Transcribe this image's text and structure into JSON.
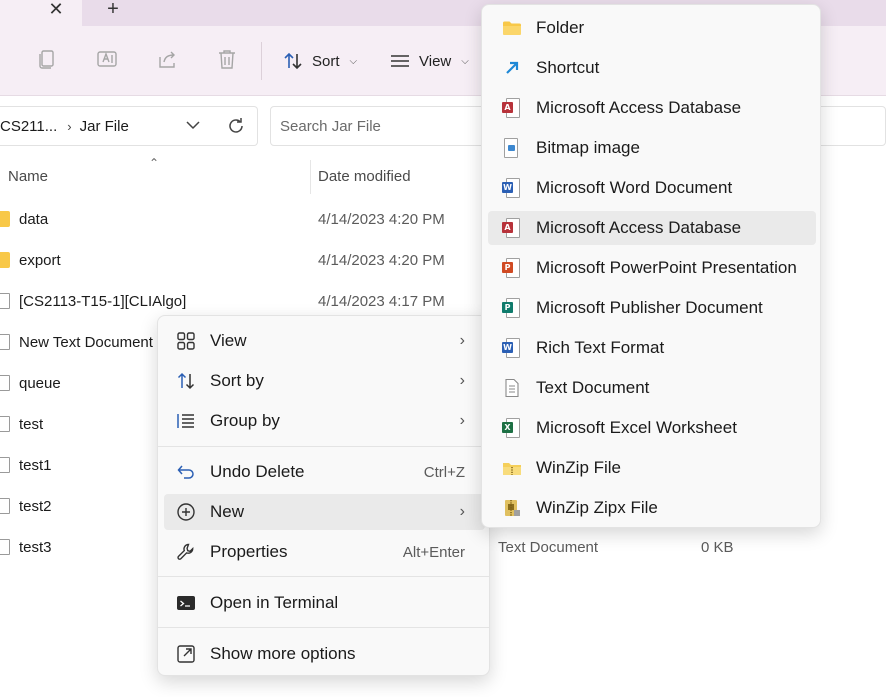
{
  "tabbar": {
    "close_glyph": "✕",
    "new_tab_glyph": "+"
  },
  "toolbar": {
    "sort_label": "Sort",
    "view_label": "View",
    "icons": [
      "copy-icon",
      "rename-icon",
      "share-icon",
      "delete-icon"
    ]
  },
  "address": {
    "crumbs": [
      "CS211...",
      "Jar File"
    ],
    "search_placeholder": "Search Jar File"
  },
  "columns": {
    "name": "Name",
    "date_modified": "Date modified"
  },
  "files": [
    {
      "name": "data",
      "date": "4/14/2023 4:20 PM",
      "kind": "folder"
    },
    {
      "name": "export",
      "date": "4/14/2023 4:20 PM",
      "kind": "folder"
    },
    {
      "name": "[CS2113-T15-1][CLIAlgo]",
      "date": "4/14/2023 4:17 PM",
      "kind": "jar"
    },
    {
      "name": "New Text Document",
      "date": "",
      "kind": "text"
    },
    {
      "name": "queue",
      "date": "",
      "kind": "text"
    },
    {
      "name": "test",
      "date": "",
      "kind": "text"
    },
    {
      "name": "test1",
      "date": "",
      "kind": "text"
    },
    {
      "name": "test2",
      "date": "",
      "kind": "text"
    },
    {
      "name": "test3",
      "date": "",
      "kind": "text"
    }
  ],
  "bg_row_extra": {
    "type": "Text Document",
    "size": "0 KB"
  },
  "context_menu": {
    "items": [
      {
        "label": "View",
        "icon": "grid-icon",
        "submenu": true
      },
      {
        "label": "Sort by",
        "icon": "sort-icon",
        "submenu": true
      },
      {
        "label": "Group by",
        "icon": "group-icon",
        "submenu": true
      },
      {
        "label": "Undo Delete",
        "icon": "undo-icon",
        "shortcut": "Ctrl+Z"
      },
      {
        "label": "New",
        "icon": "new-icon",
        "submenu": true
      },
      {
        "label": "Properties",
        "icon": "wrench-icon",
        "shortcut": "Alt+Enter"
      },
      {
        "label": "Open in Terminal",
        "icon": "terminal-icon"
      },
      {
        "label": "Show more options",
        "icon": "more-options-icon"
      }
    ]
  },
  "new_submenu": {
    "items": [
      {
        "label": "Folder",
        "icon": "folder-icon"
      },
      {
        "label": "Shortcut",
        "icon": "shortcut-icon"
      },
      {
        "label": "Microsoft Access Database",
        "icon": "access-icon"
      },
      {
        "label": "Bitmap image",
        "icon": "bitmap-icon"
      },
      {
        "label": "Microsoft Word Document",
        "icon": "word-icon"
      },
      {
        "label": "Microsoft Access Database",
        "icon": "access-icon"
      },
      {
        "label": "Microsoft PowerPoint Presentation",
        "icon": "powerpoint-icon"
      },
      {
        "label": "Microsoft Publisher Document",
        "icon": "publisher-icon"
      },
      {
        "label": "Rich Text Format",
        "icon": "rtf-icon"
      },
      {
        "label": "Text Document",
        "icon": "text-document-icon"
      },
      {
        "label": "Microsoft Excel Worksheet",
        "icon": "excel-icon"
      },
      {
        "label": "WinZip File",
        "icon": "winzip-icon"
      },
      {
        "label": "WinZip Zipx File",
        "icon": "winzip-zipx-icon"
      }
    ]
  },
  "colors": {
    "access": "#b7323a",
    "word": "#2b5fb4",
    "powerpoint": "#d04a23",
    "publisher": "#0f7b6c",
    "excel": "#1d7044",
    "folder": "#f8c848"
  }
}
